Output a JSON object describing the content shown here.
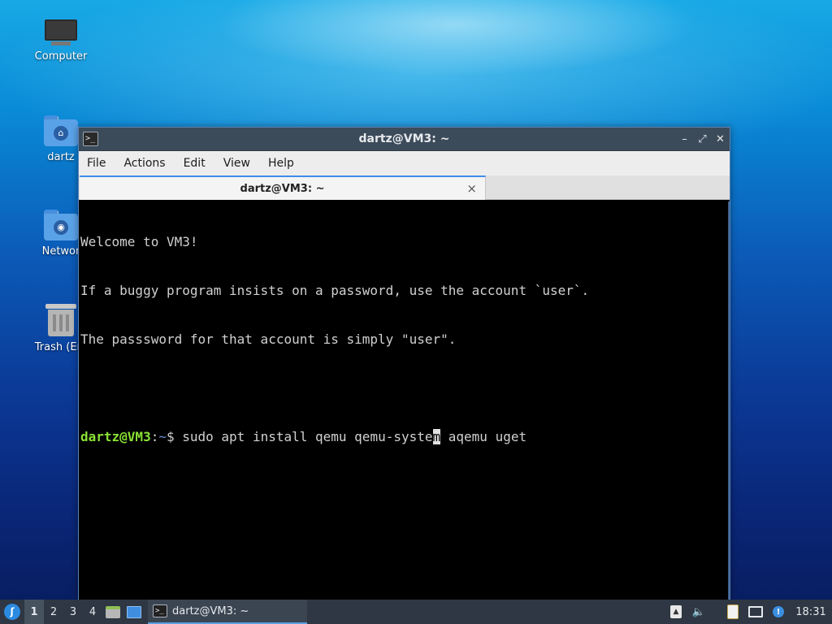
{
  "desktop": {
    "icons": [
      {
        "label": "Computer"
      },
      {
        "label": "dartz"
      },
      {
        "label": "Networ"
      },
      {
        "label": "Trash (Em"
      }
    ]
  },
  "window": {
    "title": "dartz@VM3: ~",
    "controls": {
      "minimize": "–",
      "maximize": "⤢",
      "close": "✕"
    },
    "menu": [
      "File",
      "Actions",
      "Edit",
      "View",
      "Help"
    ],
    "tab": {
      "title": "dartz@VM3: ~",
      "close": "×"
    },
    "terminal": {
      "welcome_lines": [
        "Welcome to VM3!",
        "If a buggy program insists on a password, use the account `user`.",
        "The passsword for that account is simply \"user\"."
      ],
      "prompt_user": "dartz@VM3",
      "prompt_sep": ":",
      "prompt_path": "~",
      "prompt_sign": "$ ",
      "command_before_cursor": "sudo apt install qemu qemu-syste",
      "cursor_char": "m",
      "command_after_cursor": " aqemu uget"
    }
  },
  "taskbar": {
    "workspaces": [
      "1",
      "2",
      "3",
      "4"
    ],
    "active_workspace": "1",
    "task_label": "dartz@VM3: ~",
    "clock": "18:31"
  },
  "colors": {
    "prompt_user": "#8ae234",
    "prompt_path": "#6a8ed8",
    "accent": "#3d8ee6"
  }
}
